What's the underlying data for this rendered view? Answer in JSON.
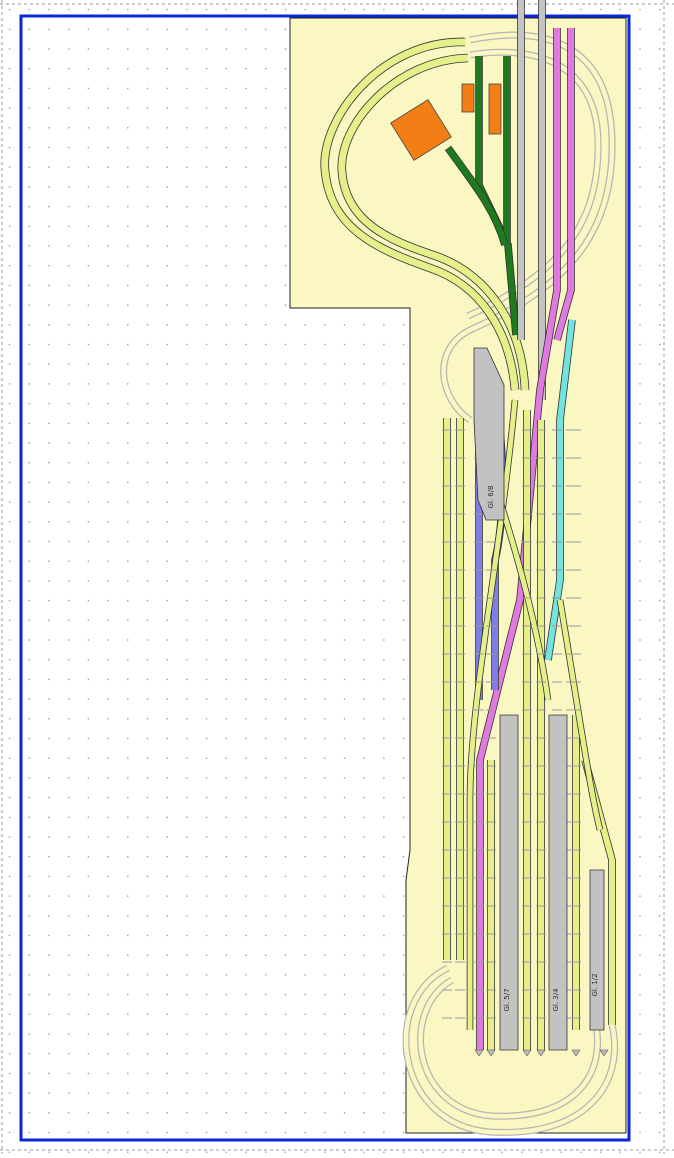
{
  "plan": {
    "platforms": [
      {
        "id": "p1",
        "label": "Gl. 1/2"
      },
      {
        "id": "p2",
        "label": "Gl. 3/4"
      },
      {
        "id": "p3",
        "label": "Gl. 5/7"
      },
      {
        "id": "p4",
        "label": "Gl. 6/8"
      }
    ]
  },
  "colors": {
    "canvas": "#ffffff",
    "grid_dot": "#7d7d7d",
    "page_border": "#9a9a9a",
    "frame": "#0a28d6",
    "baseboard": "#fbf7c2",
    "baseboard_edge": "#222222",
    "track_yellow": "#e6f08a",
    "track_magenta": "#e07ae0",
    "track_blue": "#7d7de6",
    "track_cyan": "#73e3e0",
    "track_green": "#1e7a1e",
    "track_gray": "#c4c4c4",
    "platform": "#c2c2c2",
    "building": "#f27e15",
    "sleeper": "#9a9a9a"
  }
}
